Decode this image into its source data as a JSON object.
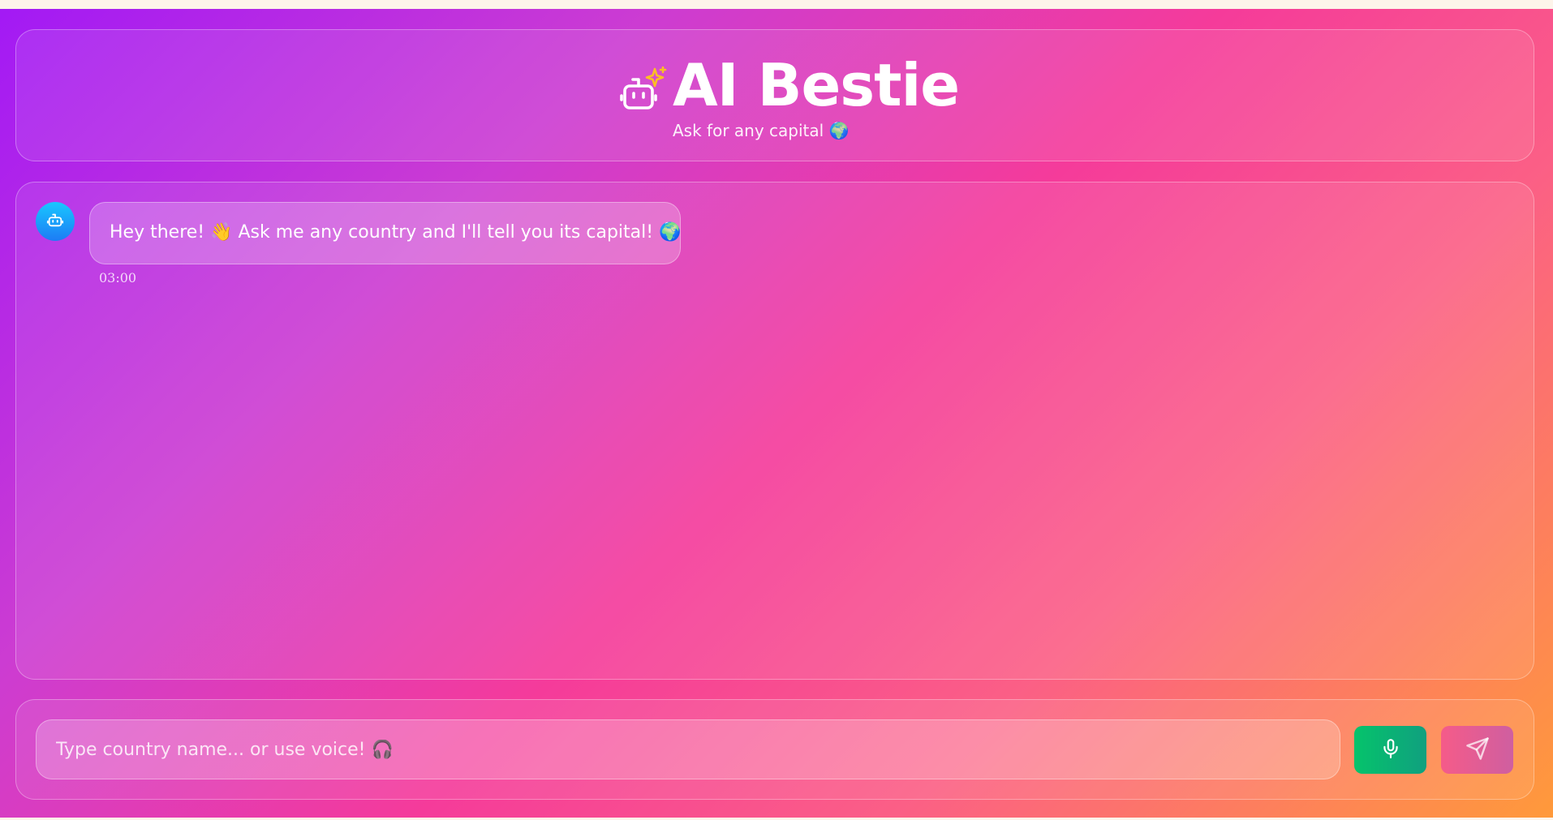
{
  "header": {
    "title": "AI Bestie",
    "subtitle": "Ask for any capital 🌍"
  },
  "icons": {
    "header_icon": "robot-sparkle-icon",
    "avatar_icon": "robot-icon",
    "mic_icon": "microphone-icon",
    "send_icon": "send-icon"
  },
  "messages": [
    {
      "sender": "bot",
      "text": "Hey there! 👋 Ask me any country and I'll tell you its capital! 🌍",
      "time": "03:00"
    }
  ],
  "input": {
    "value": "",
    "placeholder": "Type country name... or use voice! 🎧"
  },
  "colors": {
    "gradient_start": "#a219f5",
    "gradient_mid": "#f53b9a",
    "gradient_end": "#ff9a3a",
    "mic_button": "#05c36b",
    "send_button": "#f55b89",
    "avatar": "#19c7ff",
    "sparkle": "#fbbf24"
  }
}
